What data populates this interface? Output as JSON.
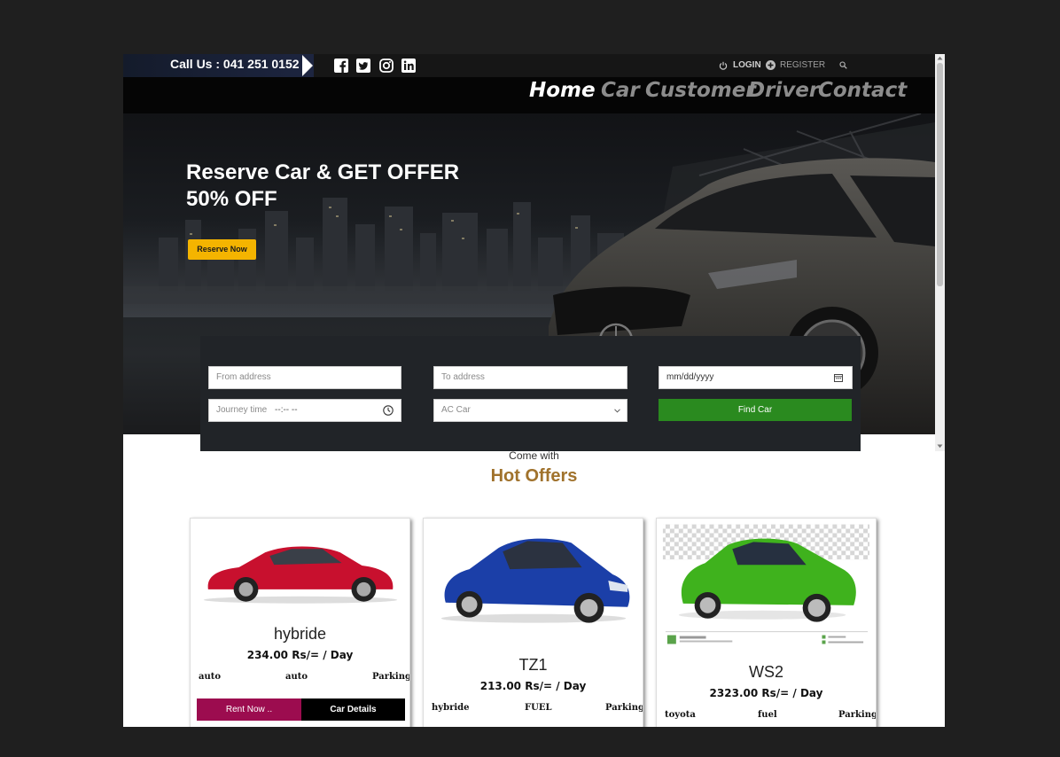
{
  "topbar": {
    "phone": "Call Us : 041 251 0152",
    "login": "LOGIN",
    "register": "REGISTER"
  },
  "nav": {
    "items": [
      "Home",
      "Car",
      "Customer",
      "Driver",
      "Contact"
    ],
    "active": "Home"
  },
  "hero": {
    "title_line1": "Reserve Car & GET OFFER",
    "title_line2": "50% OFF",
    "reserve_button": "Reserve Now"
  },
  "booking": {
    "from_placeholder": "From address",
    "to_placeholder": "To address",
    "date_placeholder": "mm/dd/yyyy",
    "time_label": "Journey time",
    "time_placeholder": "--:-- --",
    "car_type": "AC Car",
    "find_button": "Find Car"
  },
  "offers": {
    "subtitle": "Come with",
    "title": "Hot Offers",
    "cards": [
      {
        "name": "hybride",
        "price": "234.00 Rs/= / Day",
        "features": [
          "auto",
          "auto",
          "Parking"
        ],
        "rent_button": "Rent Now ..",
        "details_button": "Car Details",
        "car_color": "#c8102e"
      },
      {
        "name": "TZ1",
        "price": "213.00 Rs/= / Day",
        "features": [
          "hybride",
          "FUEL",
          "Parking"
        ],
        "car_color": "#1b3fa8"
      },
      {
        "name": "WS2",
        "price": "2323.00 Rs/= / Day",
        "features": [
          "toyota",
          "fuel",
          "Parking"
        ],
        "car_color": "#3fb21d"
      }
    ]
  },
  "colors": {
    "accent_yellow": "#f4b400",
    "find_green": "#2a8a1f",
    "rent_magenta": "#9c0c4f",
    "hot_offers_brown": "#a0722c"
  }
}
